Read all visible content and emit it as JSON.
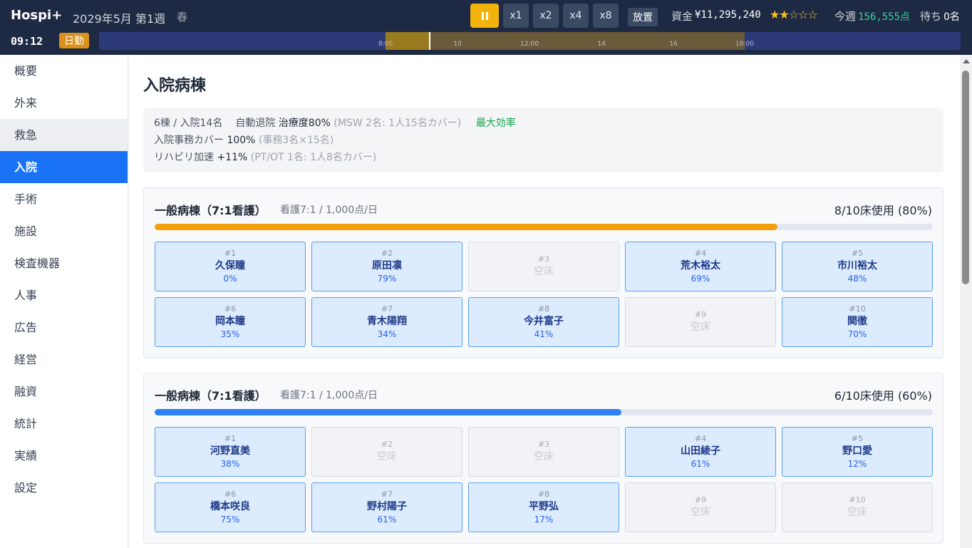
{
  "header": {
    "logo": "Hospi+",
    "date": "2029年5月 第1週",
    "season": "春",
    "speeds": [
      "x1",
      "x2",
      "x4",
      "x8"
    ],
    "houchi_label": "放置",
    "funds_label": "資金",
    "funds_value": "¥11,295,240",
    "stars": "★★☆☆☆",
    "rating_filled": 2,
    "rating_max": 5,
    "week_label": "今週",
    "week_points": "156,555点",
    "wait_label": "待ち",
    "wait_value": "0名",
    "clock": "09:12",
    "shift": "日勤",
    "timeline_ticks": [
      "8:00",
      "10",
      "12:00",
      "14",
      "16",
      "18:00"
    ]
  },
  "sidebar": {
    "items": [
      {
        "label": "概要"
      },
      {
        "label": "外来"
      },
      {
        "label": "救急"
      },
      {
        "label": "入院"
      },
      {
        "label": "手術"
      },
      {
        "label": "施設"
      },
      {
        "label": "検査機器"
      },
      {
        "label": "人事"
      },
      {
        "label": "広告"
      },
      {
        "label": "経営"
      },
      {
        "label": "融資"
      },
      {
        "label": "統計"
      },
      {
        "label": "実績"
      },
      {
        "label": "設定"
      }
    ],
    "active": "入院"
  },
  "main": {
    "title": "入院病棟",
    "summary": {
      "line1_a": "6棟 / 入院14名",
      "line1_b": "自動退院",
      "line1_c": "治療度80%",
      "line1_d": "(MSW 2名: 1人15名カバー)",
      "line1_e": "最大効率",
      "line2_a": "入院事務カバー",
      "line2_b": "100%",
      "line2_c": "(事務3名×15名)",
      "line3_a": "リハビリ加速",
      "line3_b": "+11%",
      "line3_c": "(PT/OT 1名: 1人8名カバー)"
    },
    "wards": [
      {
        "title": "一般病棟（7:1看護）",
        "sub": "看護7:1 / 1,000点/日",
        "usage": "8/10床使用 (80%)",
        "fill_pct": 80,
        "color": "#f59e0b",
        "beds": [
          {
            "no": "#1",
            "name": "久保瞳",
            "pct": "0%"
          },
          {
            "no": "#2",
            "name": "原田凛",
            "pct": "79%"
          },
          {
            "no": "#3",
            "empty": "空床"
          },
          {
            "no": "#4",
            "name": "荒木裕太",
            "pct": "69%"
          },
          {
            "no": "#5",
            "name": "市川裕太",
            "pct": "48%"
          },
          {
            "no": "#6",
            "name": "岡本瞳",
            "pct": "35%"
          },
          {
            "no": "#7",
            "name": "青木陽翔",
            "pct": "34%"
          },
          {
            "no": "#8",
            "name": "今井富子",
            "pct": "41%"
          },
          {
            "no": "#9",
            "empty": "空床"
          },
          {
            "no": "#10",
            "name": "関徹",
            "pct": "70%"
          }
        ]
      },
      {
        "title": "一般病棟（7:1看護）",
        "sub": "看護7:1 / 1,000点/日",
        "usage": "6/10床使用 (60%)",
        "fill_pct": 60,
        "color": "#2f80f5",
        "beds": [
          {
            "no": "#1",
            "name": "河野直美",
            "pct": "38%"
          },
          {
            "no": "#2",
            "empty": "空床"
          },
          {
            "no": "#3",
            "empty": "空床"
          },
          {
            "no": "#4",
            "name": "山田綾子",
            "pct": "61%"
          },
          {
            "no": "#5",
            "name": "野口愛",
            "pct": "12%"
          },
          {
            "no": "#6",
            "name": "橋本咲良",
            "pct": "75%"
          },
          {
            "no": "#7",
            "name": "野村陽子",
            "pct": "61%"
          },
          {
            "no": "#8",
            "name": "平野弘",
            "pct": "17%"
          },
          {
            "no": "#9",
            "empty": "空床"
          },
          {
            "no": "#10",
            "empty": "空床"
          }
        ]
      }
    ]
  }
}
